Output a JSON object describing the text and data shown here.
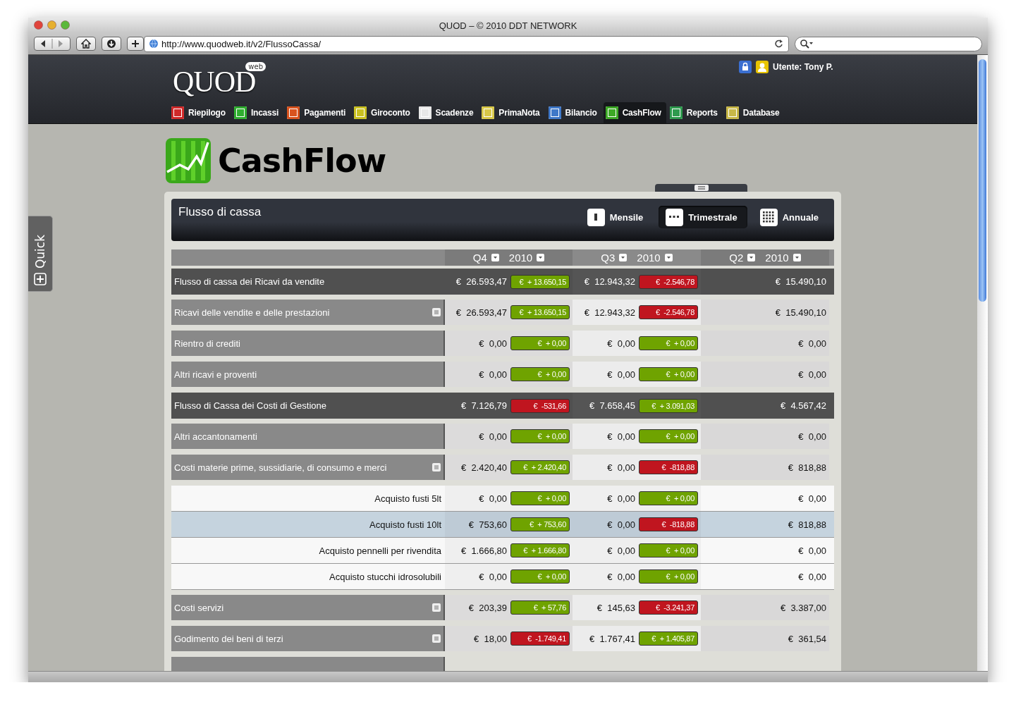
{
  "window": {
    "title": "QUOD – © 2010 DDT NETWORK",
    "url": "http://www.quodweb.it/v2/FlussoCassa/"
  },
  "header": {
    "logo": "QUOD",
    "logo_badge": "web",
    "user": "Utente: Tony P.",
    "nav": [
      {
        "label": "Riepilogo",
        "color": "#d02a2a",
        "selected": false
      },
      {
        "label": "Incassi",
        "color": "#2fae2f",
        "selected": false
      },
      {
        "label": "Pagamenti",
        "color": "#d9531e",
        "selected": false
      },
      {
        "label": "Giroconto",
        "color": "#c8c020",
        "selected": false
      },
      {
        "label": "Scadenze",
        "color": "#e8e8e8",
        "selected": false
      },
      {
        "label": "PrimaNota",
        "color": "#d8c848",
        "selected": false
      },
      {
        "label": "Bilancio",
        "color": "#3f78c8",
        "selected": false
      },
      {
        "label": "CashFlow",
        "color": "#3ca825",
        "selected": true
      },
      {
        "label": "Reports",
        "color": "#2e9a4e",
        "selected": false
      },
      {
        "label": "Database",
        "color": "#c8b848",
        "selected": false
      }
    ]
  },
  "quick_tab": {
    "label": "Quick"
  },
  "page_title": "CashFlow",
  "panel": {
    "title": "Flusso di cassa",
    "periods": [
      {
        "label": "Mensile",
        "kind": "month",
        "selected": false
      },
      {
        "label": "Trimestrale",
        "kind": "quarter",
        "selected": true
      },
      {
        "label": "Annuale",
        "kind": "year",
        "selected": false
      }
    ],
    "columns": [
      {
        "quarter": "Q4",
        "year": "2010"
      },
      {
        "quarter": "Q3",
        "year": "2010"
      },
      {
        "quarter": "Q2",
        "year": "2010"
      }
    ],
    "rows": [
      {
        "kind": "total",
        "label": "Flusso di cassa dei Ricavi da vendite",
        "has_menu": false,
        "selected": false,
        "cells": [
          {
            "value": "€  26.593,47",
            "delta": "€  + 13.650,15",
            "color": "#6fa300"
          },
          {
            "value": "€  12.943,32",
            "delta": "€  -2.546,78",
            "color": "#c0151f"
          },
          {
            "value": "€  15.490,10"
          }
        ]
      },
      {
        "kind": "category",
        "label": "Ricavi delle vendite e delle prestazioni",
        "has_menu": true,
        "selected": false,
        "cells": [
          {
            "value": "€  26.593,47",
            "delta": "€  + 13.650,15",
            "color": "#6fa300"
          },
          {
            "value": "€  12.943,32",
            "delta": "€  -2.546,78",
            "color": "#c0151f"
          },
          {
            "value": "€  15.490,10"
          }
        ]
      },
      {
        "kind": "category",
        "label": "Rientro di crediti",
        "has_menu": false,
        "selected": false,
        "cells": [
          {
            "value": "€  0,00",
            "delta": "€  + 0,00",
            "color": "#6fa300"
          },
          {
            "value": "€  0,00",
            "delta": "€  + 0,00",
            "color": "#6fa300"
          },
          {
            "value": "€  0,00"
          }
        ]
      },
      {
        "kind": "category",
        "label": "Altri ricavi e proventi",
        "has_menu": false,
        "selected": false,
        "cells": [
          {
            "value": "€  0,00",
            "delta": "€  + 0,00",
            "color": "#6fa300"
          },
          {
            "value": "€  0,00",
            "delta": "€  + 0,00",
            "color": "#6fa300"
          },
          {
            "value": "€  0,00"
          }
        ]
      },
      {
        "kind": "total",
        "label": "Flusso di Cassa dei Costi di Gestione",
        "has_menu": false,
        "selected": false,
        "cells": [
          {
            "value": "€  7.126,79",
            "delta": "€  -531,66",
            "color": "#c0151f"
          },
          {
            "value": "€  7.658,45",
            "delta": "€  + 3.091,03",
            "color": "#6fa300"
          },
          {
            "value": "€  4.567,42"
          }
        ]
      },
      {
        "kind": "category",
        "label": "Altri accantonamenti",
        "has_menu": false,
        "selected": false,
        "cells": [
          {
            "value": "€  0,00",
            "delta": "€  + 0,00",
            "color": "#6fa300"
          },
          {
            "value": "€  0,00",
            "delta": "€  + 0,00",
            "color": "#6fa300"
          },
          {
            "value": "€  0,00"
          }
        ]
      },
      {
        "kind": "category",
        "label": "Costi materie prime, sussidiarie, di consumo e merci",
        "has_menu": true,
        "selected": false,
        "cells": [
          {
            "value": "€  2.420,40",
            "delta": "€  + 2.420,40",
            "color": "#6fa300"
          },
          {
            "value": "€  0,00",
            "delta": "€  -818,88",
            "color": "#c0151f"
          },
          {
            "value": "€  818,88"
          }
        ]
      },
      {
        "kind": "item",
        "label": "Acquisto fusti 5lt",
        "has_menu": false,
        "selected": false,
        "cells": [
          {
            "value": "€  0,00",
            "delta": "€  + 0,00",
            "color": "#6fa300"
          },
          {
            "value": "€  0,00",
            "delta": "€  + 0,00",
            "color": "#6fa300"
          },
          {
            "value": "€  0,00"
          }
        ]
      },
      {
        "kind": "item",
        "label": "Acquisto fusti 10lt",
        "has_menu": false,
        "selected": true,
        "cells": [
          {
            "value": "€  753,60",
            "delta": "€  + 753,60",
            "color": "#6fa300"
          },
          {
            "value": "€  0,00",
            "delta": "€  -818,88",
            "color": "#c0151f"
          },
          {
            "value": "€  818,88"
          }
        ]
      },
      {
        "kind": "item",
        "label": "Acquisto pennelli per rivendita",
        "has_menu": false,
        "selected": false,
        "cells": [
          {
            "value": "€  1.666,80",
            "delta": "€  + 1.666,80",
            "color": "#6fa300"
          },
          {
            "value": "€  0,00",
            "delta": "€  + 0,00",
            "color": "#6fa300"
          },
          {
            "value": "€  0,00"
          }
        ]
      },
      {
        "kind": "item",
        "label": "Acquisto stucchi idrosolubili",
        "has_menu": false,
        "selected": false,
        "cells": [
          {
            "value": "€  0,00",
            "delta": "€  + 0,00",
            "color": "#6fa300"
          },
          {
            "value": "€  0,00",
            "delta": "€  + 0,00",
            "color": "#6fa300"
          },
          {
            "value": "€  0,00"
          }
        ]
      },
      {
        "kind": "category",
        "label": "Costi servizi",
        "has_menu": true,
        "selected": false,
        "cells": [
          {
            "value": "€  203,39",
            "delta": "€  + 57,76",
            "color": "#6fa300"
          },
          {
            "value": "€  145,63",
            "delta": "€  -3.241,37",
            "color": "#c0151f"
          },
          {
            "value": "€  3.387,00"
          }
        ]
      },
      {
        "kind": "category",
        "label": "Godimento dei beni di terzi",
        "has_menu": true,
        "selected": false,
        "cells": [
          {
            "value": "€  18,00",
            "delta": "€  -1.749,41",
            "color": "#c0151f"
          },
          {
            "value": "€  1.767,41",
            "delta": "€  + 1.405,87",
            "color": "#6fa300"
          },
          {
            "value": "€  361,54"
          }
        ]
      }
    ]
  }
}
